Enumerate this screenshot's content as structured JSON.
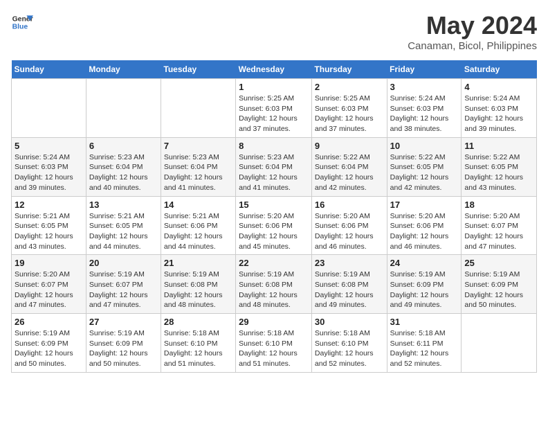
{
  "header": {
    "logo_line1": "General",
    "logo_line2": "Blue",
    "month": "May 2024",
    "location": "Canaman, Bicol, Philippines"
  },
  "weekdays": [
    "Sunday",
    "Monday",
    "Tuesday",
    "Wednesday",
    "Thursday",
    "Friday",
    "Saturday"
  ],
  "weeks": [
    [
      {
        "day": "",
        "info": ""
      },
      {
        "day": "",
        "info": ""
      },
      {
        "day": "",
        "info": ""
      },
      {
        "day": "1",
        "info": "Sunrise: 5:25 AM\nSunset: 6:03 PM\nDaylight: 12 hours\nand 37 minutes."
      },
      {
        "day": "2",
        "info": "Sunrise: 5:25 AM\nSunset: 6:03 PM\nDaylight: 12 hours\nand 37 minutes."
      },
      {
        "day": "3",
        "info": "Sunrise: 5:24 AM\nSunset: 6:03 PM\nDaylight: 12 hours\nand 38 minutes."
      },
      {
        "day": "4",
        "info": "Sunrise: 5:24 AM\nSunset: 6:03 PM\nDaylight: 12 hours\nand 39 minutes."
      }
    ],
    [
      {
        "day": "5",
        "info": "Sunrise: 5:24 AM\nSunset: 6:03 PM\nDaylight: 12 hours\nand 39 minutes."
      },
      {
        "day": "6",
        "info": "Sunrise: 5:23 AM\nSunset: 6:04 PM\nDaylight: 12 hours\nand 40 minutes."
      },
      {
        "day": "7",
        "info": "Sunrise: 5:23 AM\nSunset: 6:04 PM\nDaylight: 12 hours\nand 41 minutes."
      },
      {
        "day": "8",
        "info": "Sunrise: 5:23 AM\nSunset: 6:04 PM\nDaylight: 12 hours\nand 41 minutes."
      },
      {
        "day": "9",
        "info": "Sunrise: 5:22 AM\nSunset: 6:04 PM\nDaylight: 12 hours\nand 42 minutes."
      },
      {
        "day": "10",
        "info": "Sunrise: 5:22 AM\nSunset: 6:05 PM\nDaylight: 12 hours\nand 42 minutes."
      },
      {
        "day": "11",
        "info": "Sunrise: 5:22 AM\nSunset: 6:05 PM\nDaylight: 12 hours\nand 43 minutes."
      }
    ],
    [
      {
        "day": "12",
        "info": "Sunrise: 5:21 AM\nSunset: 6:05 PM\nDaylight: 12 hours\nand 43 minutes."
      },
      {
        "day": "13",
        "info": "Sunrise: 5:21 AM\nSunset: 6:05 PM\nDaylight: 12 hours\nand 44 minutes."
      },
      {
        "day": "14",
        "info": "Sunrise: 5:21 AM\nSunset: 6:06 PM\nDaylight: 12 hours\nand 44 minutes."
      },
      {
        "day": "15",
        "info": "Sunrise: 5:20 AM\nSunset: 6:06 PM\nDaylight: 12 hours\nand 45 minutes."
      },
      {
        "day": "16",
        "info": "Sunrise: 5:20 AM\nSunset: 6:06 PM\nDaylight: 12 hours\nand 46 minutes."
      },
      {
        "day": "17",
        "info": "Sunrise: 5:20 AM\nSunset: 6:06 PM\nDaylight: 12 hours\nand 46 minutes."
      },
      {
        "day": "18",
        "info": "Sunrise: 5:20 AM\nSunset: 6:07 PM\nDaylight: 12 hours\nand 47 minutes."
      }
    ],
    [
      {
        "day": "19",
        "info": "Sunrise: 5:20 AM\nSunset: 6:07 PM\nDaylight: 12 hours\nand 47 minutes."
      },
      {
        "day": "20",
        "info": "Sunrise: 5:19 AM\nSunset: 6:07 PM\nDaylight: 12 hours\nand 47 minutes."
      },
      {
        "day": "21",
        "info": "Sunrise: 5:19 AM\nSunset: 6:08 PM\nDaylight: 12 hours\nand 48 minutes."
      },
      {
        "day": "22",
        "info": "Sunrise: 5:19 AM\nSunset: 6:08 PM\nDaylight: 12 hours\nand 48 minutes."
      },
      {
        "day": "23",
        "info": "Sunrise: 5:19 AM\nSunset: 6:08 PM\nDaylight: 12 hours\nand 49 minutes."
      },
      {
        "day": "24",
        "info": "Sunrise: 5:19 AM\nSunset: 6:09 PM\nDaylight: 12 hours\nand 49 minutes."
      },
      {
        "day": "25",
        "info": "Sunrise: 5:19 AM\nSunset: 6:09 PM\nDaylight: 12 hours\nand 50 minutes."
      }
    ],
    [
      {
        "day": "26",
        "info": "Sunrise: 5:19 AM\nSunset: 6:09 PM\nDaylight: 12 hours\nand 50 minutes."
      },
      {
        "day": "27",
        "info": "Sunrise: 5:19 AM\nSunset: 6:09 PM\nDaylight: 12 hours\nand 50 minutes."
      },
      {
        "day": "28",
        "info": "Sunrise: 5:18 AM\nSunset: 6:10 PM\nDaylight: 12 hours\nand 51 minutes."
      },
      {
        "day": "29",
        "info": "Sunrise: 5:18 AM\nSunset: 6:10 PM\nDaylight: 12 hours\nand 51 minutes."
      },
      {
        "day": "30",
        "info": "Sunrise: 5:18 AM\nSunset: 6:10 PM\nDaylight: 12 hours\nand 52 minutes."
      },
      {
        "day": "31",
        "info": "Sunrise: 5:18 AM\nSunset: 6:11 PM\nDaylight: 12 hours\nand 52 minutes."
      },
      {
        "day": "",
        "info": ""
      }
    ]
  ]
}
